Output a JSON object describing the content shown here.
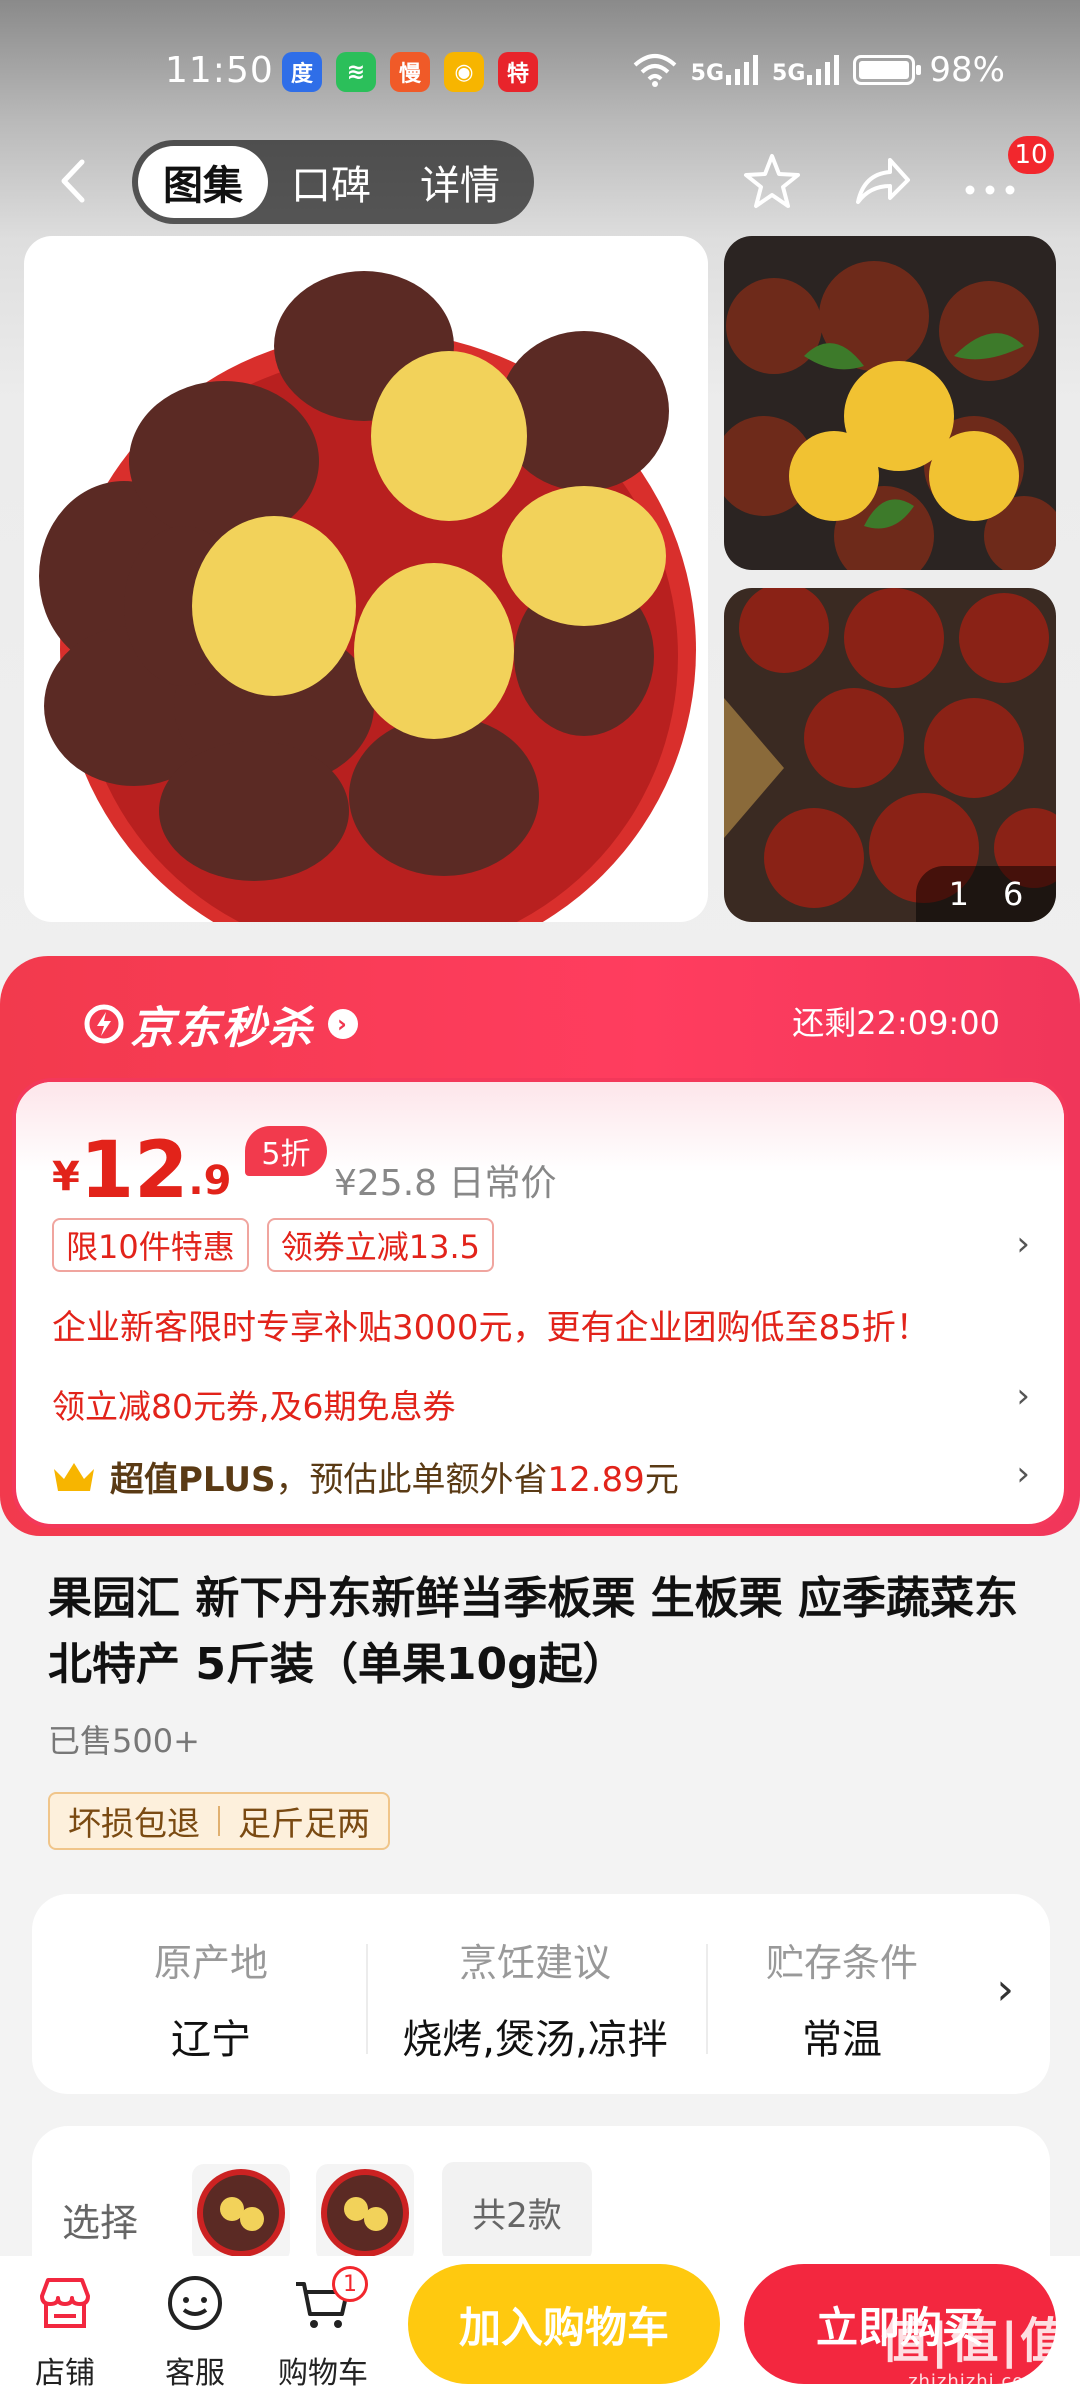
{
  "status_bar": {
    "time": "11:50",
    "battery": "98%",
    "signal1": "5G",
    "signal2": "5G",
    "app_icons": [
      "baidu-icon",
      "chat-icon",
      "man-icon",
      "weibo-icon",
      "te-icon"
    ],
    "app_glyphs": [
      "度",
      "≋",
      "慢",
      "◉",
      "特"
    ]
  },
  "nav": {
    "tabs": [
      {
        "label": "图集",
        "active": true
      },
      {
        "label": "口碑",
        "active": false
      },
      {
        "label": "详情",
        "active": false
      }
    ],
    "message_badge": "10"
  },
  "gallery": {
    "counter_current": "1",
    "counter_total": "6"
  },
  "seckill": {
    "title": "京东秒杀",
    "timer": "还剩22:09:00"
  },
  "price": {
    "currency": "¥",
    "integer": "12",
    "decimal": ".9",
    "discount_badge": "5折",
    "original": "¥25.8 日常价",
    "tags": [
      "限10件特惠",
      "领券立减13.5"
    ],
    "promo_text": "企业新客限时专享补贴3000元，更有企业团购低至85折！",
    "coupon_text": "领立减80元券,及6期免息券",
    "plus_label": "超值PLUS",
    "plus_text": "，预估此单额外省",
    "plus_amount": "12.89",
    "plus_unit": "元"
  },
  "product": {
    "title": "果园汇 新下丹东新鲜当季板栗 生板栗 应季蔬菜东北特产 5斤装（单果10g起）",
    "sold": "已售500+",
    "guarantees": [
      "坏损包退",
      "足斤足两"
    ]
  },
  "attributes": [
    {
      "key": "原产地",
      "value": "辽宁"
    },
    {
      "key": "烹饪建议",
      "value": "烧烤,煲汤,凉拌"
    },
    {
      "key": "贮存条件",
      "value": "常温"
    }
  ],
  "select": {
    "label": "选择",
    "count": "共2款"
  },
  "bottom_bar": {
    "shop": "店铺",
    "service": "客服",
    "cart": "购物车",
    "cart_badge": "1",
    "add_to_cart": "加入购物车",
    "buy_now": "立即购买"
  },
  "watermark": {
    "main": "值|值|值",
    "sub": "zhizhizhi.com"
  },
  "colors": {
    "accent": "#f3273f",
    "cart_button": "#ffc90f",
    "price_red": "#e2231a"
  }
}
